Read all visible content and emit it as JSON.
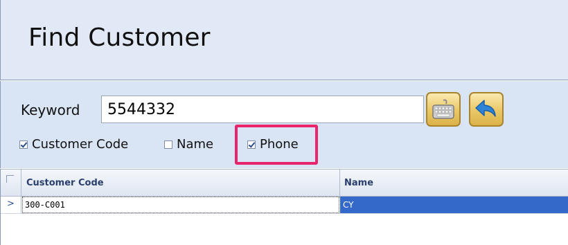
{
  "header": {
    "title": "Find Customer"
  },
  "search": {
    "keyword_label": "Keyword",
    "keyword_value": "5544332"
  },
  "buttons": {
    "keyboard_icon": "keyboard-icon",
    "back_icon": "back-arrow-icon"
  },
  "filters": [
    {
      "label": "Customer Code",
      "checked": true
    },
    {
      "label": "Name",
      "checked": false
    },
    {
      "label": "Phone",
      "checked": true
    }
  ],
  "grid": {
    "columns": [
      "Customer Code",
      "Name"
    ],
    "rows": [
      {
        "indicator": ">",
        "customer_code": "300-C001",
        "name": "CY"
      }
    ]
  },
  "colors": {
    "header_bg": "#e1e9f6",
    "selection": "#3468c9",
    "highlight": "#e8246a"
  }
}
